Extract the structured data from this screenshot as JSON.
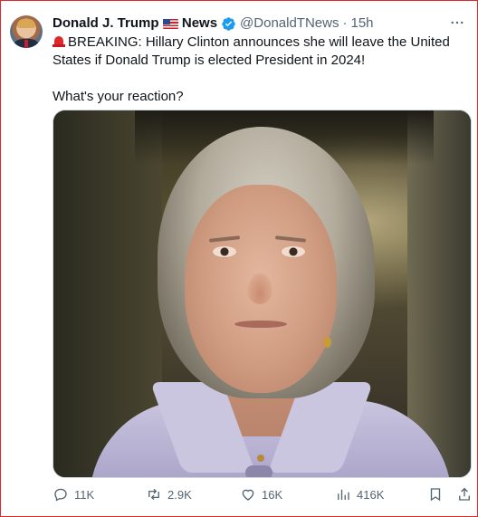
{
  "tweet": {
    "author_name": "Donald J. Trump",
    "author_name_suffix": "News",
    "handle": "@DonaldTNews",
    "separator": "·",
    "time": "15h",
    "text_line1": "BREAKING: Hillary Clinton announces she will leave the United States if Donald Trump is elected President in 2024!",
    "text_line2": "What's your reaction?",
    "verified_color": "#1d9bf0"
  },
  "actions": {
    "replies": "11K",
    "reposts": "2.9K",
    "likes": "16K",
    "views": "416K"
  },
  "icons": {
    "avatar": "trump-avatar",
    "flag": "us-flag-emoji",
    "verified": "verified-badge-icon",
    "more": "more-icon",
    "siren": "siren-emoji",
    "reply": "reply-icon",
    "repost": "repost-icon",
    "like": "heart-icon",
    "views": "views-icon",
    "bookmark": "bookmark-icon",
    "share": "share-icon"
  }
}
